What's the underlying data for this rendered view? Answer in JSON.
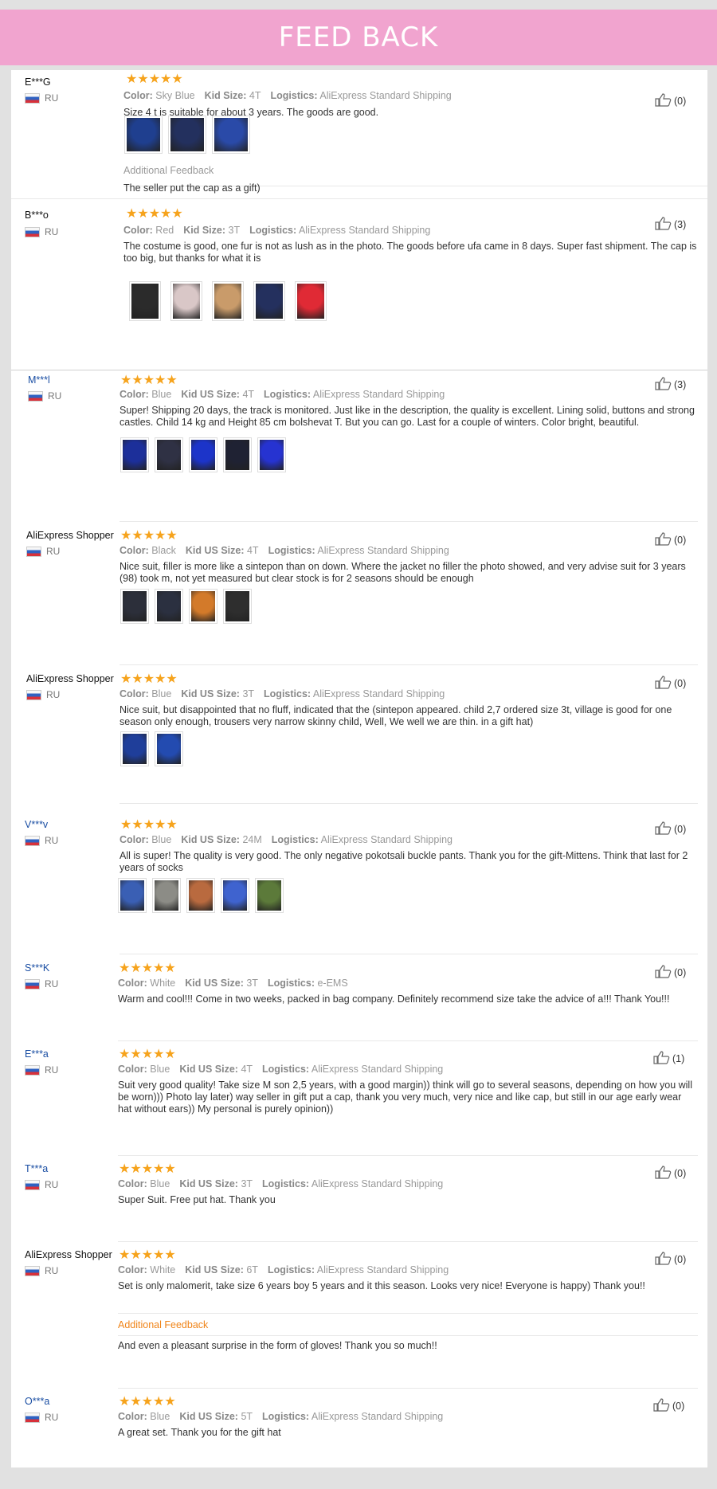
{
  "banner": {
    "title": "FEED BACK"
  },
  "labels": {
    "color": "Color:",
    "kid_size": "Kid Size:",
    "kid_us_size": "Kid US Size:",
    "logistics": "Logistics:"
  },
  "reviews": [
    {
      "user": "E***G",
      "country": "RU",
      "stars": "★★★★★",
      "color": "Sky Blue",
      "size_label": "Kid Size:",
      "size": "4T",
      "logistics": "AliExpress Standard Shipping",
      "text": "Size 4 t is suitable for about 3 years. The goods are good.",
      "helpful": "(0)",
      "additional_label": "Additional Feedback",
      "additional_text": "The seller put the cap as a gift)"
    },
    {
      "user": "B***o",
      "country": "RU",
      "stars": "★★★★★",
      "color": "Red",
      "size_label": "Kid Size:",
      "size": "3T",
      "logistics": "AliExpress Standard Shipping",
      "text": "The costume is good, one fur is not as lush as in the photo. The goods before ufa came in 8 days. Super fast shipment. The cap is too big, but thanks for what it is",
      "helpful": "(3)"
    },
    {
      "user": "M***l",
      "country": "RU",
      "stars": "★★★★★",
      "color": "Blue",
      "size_label": "Kid US Size:",
      "size": "4T",
      "logistics": "AliExpress Standard Shipping",
      "text": "Super! Shipping 20 days, the track is monitored. Just like in the description, the quality is excellent. Lining solid, buttons and strong castles. Child 14 kg and Height 85 cm bolshevat T. But you can go. Last for a couple of winters. Color bright, beautiful.",
      "helpful": "(3)"
    },
    {
      "user": "AliExpress Shopper",
      "country": "RU",
      "stars": "★★★★★",
      "color": "Black",
      "size_label": "Kid US Size:",
      "size": "4T",
      "logistics": "AliExpress Standard Shipping",
      "text": "Nice suit, filler is more like a sintepon than on down. Where the jacket no filler the photo showed, and very advise suit for 3 years (98) took m, not yet measured but clear stock is for 2 seasons should be enough",
      "helpful": "(0)"
    },
    {
      "user": "AliExpress Shopper",
      "country": "RU",
      "stars": "★★★★★",
      "color": "Blue",
      "size_label": "Kid US Size:",
      "size": "3T",
      "logistics": "AliExpress Standard Shipping",
      "text": "Nice suit, but disappointed that no fluff, indicated that the (sintepon appeared. child 2,7 ordered size 3t, village is good for one season only enough, trousers very narrow skinny child, Well, We well we are thin. in a gift hat)",
      "helpful": "(0)"
    },
    {
      "user": "V***v",
      "country": "RU",
      "stars": "★★★★★",
      "color": "Blue",
      "size_label": "Kid US Size:",
      "size": "24M",
      "logistics": "AliExpress Standard Shipping",
      "text": "All is super! The quality is very good. The only negative pokotsali buckle pants. Thank you for the gift-Mittens. Think that last for 2 years of socks",
      "helpful": "(0)"
    },
    {
      "user": "S***K",
      "country": "RU",
      "stars": "★★★★★",
      "color": "White",
      "size_label": "Kid US Size:",
      "size": "3T",
      "logistics": "e-EMS",
      "text": "Warm and cool!!! Come in two weeks, packed in bag company. Definitely recommend size take the advice of a!!! Thank You!!!",
      "helpful": "(0)"
    },
    {
      "user": "E***a",
      "country": "RU",
      "stars": "★★★★★",
      "color": "Blue",
      "size_label": "Kid US Size:",
      "size": "4T",
      "logistics": "AliExpress Standard Shipping",
      "text": "Suit very good quality! Take size M son 2,5 years, with a good margin)) think will go to several seasons, depending on how you will be worn))) Photo lay later) way seller in gift put a cap, thank you very much, very nice and like cap, but still in our age early wear hat without ears)) My personal is purely opinion))",
      "helpful": "(1)"
    },
    {
      "user": "T***a",
      "country": "RU",
      "stars": "★★★★★",
      "color": "Blue",
      "size_label": "Kid US Size:",
      "size": "3T",
      "logistics": "AliExpress Standard Shipping",
      "text": "Super Suit. Free put hat. Thank you",
      "helpful": "(0)"
    },
    {
      "user": "AliExpress Shopper",
      "country": "RU",
      "stars": "★★★★★",
      "color": "White",
      "size_label": "Kid US Size:",
      "size": "6T",
      "logistics": "AliExpress Standard Shipping",
      "text": "Set is only malomerit, take size 6 years boy 5 years and it this season. Looks very nice! Everyone is happy) Thank you!!",
      "helpful": "(0)",
      "additional_label": "Additional Feedback",
      "additional_text": "And even a pleasant surprise in the form of gloves! Thank you so much!!"
    },
    {
      "user": "O***a",
      "country": "RU",
      "stars": "★★★★★",
      "color": "Blue",
      "size_label": "Kid US Size:",
      "size": "5T",
      "logistics": "AliExpress Standard Shipping",
      "text": "A great set. Thank you for the gift hat",
      "helpful": "(0)"
    }
  ],
  "photo_colors": {
    "r0": [
      "#1f3f8f",
      "#23305e",
      "#2a4aa8"
    ],
    "r1": [
      "#2b2b2b",
      "#d9c7c7",
      "#c99b6a",
      "#24305e",
      "#e02a35"
    ],
    "r2": [
      "#1c2f9a",
      "#2f3144",
      "#1c34c9",
      "#1f2233",
      "#2633d1"
    ],
    "r3": [
      "#2c2f3a",
      "#2b3040",
      "#d37a2a",
      "#2e2e2e"
    ],
    "r4": [
      "#1f3e9a",
      "#234bb0"
    ],
    "r5": [
      "#3a5fb4",
      "#8c8c86",
      "#b96a3f",
      "#3f63cf",
      "#5c7a3a"
    ]
  }
}
